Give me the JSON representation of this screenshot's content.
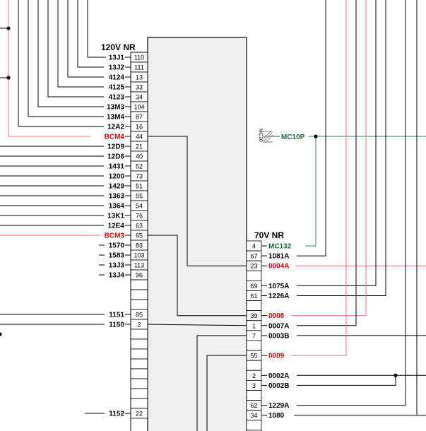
{
  "colors": {
    "black": "#000000",
    "red": "#e00000",
    "green": "#1a6b3a",
    "gray": "#707070",
    "box_fill": "#f0f0f0",
    "red_wire": "#f07070",
    "green_wire": "#2e8b57"
  },
  "left_connector": {
    "title": "120V NR",
    "rows": [
      {
        "label": "13J1",
        "pin": "110",
        "color": "black"
      },
      {
        "label": "13J2",
        "pin": "111",
        "color": "black"
      },
      {
        "label": "4124",
        "pin": "13",
        "color": "black"
      },
      {
        "label": "4125",
        "pin": "33",
        "color": "black"
      },
      {
        "label": "4123",
        "pin": "34",
        "color": "black"
      },
      {
        "label": "13M3",
        "pin": "104",
        "color": "black"
      },
      {
        "label": "13M4",
        "pin": "87",
        "color": "black"
      },
      {
        "label": "12A2",
        "pin": "16",
        "color": "black"
      },
      {
        "label": "BCM4",
        "pin": "44",
        "color": "red"
      },
      {
        "label": "12D9",
        "pin": "21",
        "color": "black"
      },
      {
        "label": "12D6",
        "pin": "40",
        "color": "black"
      },
      {
        "label": "1431",
        "pin": "52",
        "color": "black"
      },
      {
        "label": "1200",
        "pin": "73",
        "color": "black"
      },
      {
        "label": "1429",
        "pin": "51",
        "color": "black"
      },
      {
        "label": "1363",
        "pin": "55",
        "color": "black"
      },
      {
        "label": "1364",
        "pin": "54",
        "color": "black"
      },
      {
        "label": "13K1",
        "pin": "76",
        "color": "black"
      },
      {
        "label": "12E4",
        "pin": "63",
        "color": "black"
      },
      {
        "label": "BCM3",
        "pin": "65",
        "color": "red"
      },
      {
        "label": "1570",
        "pin": "83",
        "color": "black"
      },
      {
        "label": "1583",
        "pin": "103",
        "color": "black"
      },
      {
        "label": "13J3",
        "pin": "113",
        "color": "black"
      },
      {
        "label": "13J4",
        "pin": "96",
        "color": "black"
      },
      {
        "label": "",
        "pin": "",
        "color": "black"
      },
      {
        "label": "",
        "pin": "",
        "color": "black"
      },
      {
        "label": "",
        "pin": "",
        "color": "black"
      },
      {
        "label": "1151",
        "pin": "85",
        "color": "black"
      },
      {
        "label": "1150",
        "pin": "2",
        "color": "black"
      },
      {
        "label": "",
        "pin": "",
        "color": "black"
      },
      {
        "label": "",
        "pin": "",
        "color": "black"
      },
      {
        "label": "",
        "pin": "",
        "color": "black"
      },
      {
        "label": "",
        "pin": "",
        "color": "black"
      },
      {
        "label": "",
        "pin": "",
        "color": "black"
      },
      {
        "label": "",
        "pin": "",
        "color": "black"
      },
      {
        "label": "",
        "pin": "",
        "color": "black"
      },
      {
        "label": "",
        "pin": "",
        "color": "black"
      },
      {
        "label": "1152",
        "pin": "22",
        "color": "black"
      }
    ]
  },
  "right_connector": {
    "title": "70V NR",
    "rows": [
      {
        "label": "MC132",
        "pin": "4",
        "color": "green"
      },
      {
        "label": "1081A",
        "pin": "67",
        "color": "black"
      },
      {
        "label": "0004A",
        "pin": "23",
        "color": "red"
      },
      {
        "label": "",
        "pin": "",
        "color": "black"
      },
      {
        "label": "1075A",
        "pin": "69",
        "color": "black"
      },
      {
        "label": "1226A",
        "pin": "61",
        "color": "black"
      },
      {
        "label": "",
        "pin": "",
        "color": "black"
      },
      {
        "label": "0008",
        "pin": "39",
        "color": "red"
      },
      {
        "label": "0007A",
        "pin": "1",
        "color": "black"
      },
      {
        "label": "0003B",
        "pin": "7",
        "color": "black"
      },
      {
        "label": "",
        "pin": "",
        "color": "black"
      },
      {
        "label": "0009",
        "pin": "55",
        "color": "red"
      },
      {
        "label": "",
        "pin": "",
        "color": "black"
      },
      {
        "label": "0002A",
        "pin": "2",
        "color": "black"
      },
      {
        "label": "0002B",
        "pin": "3",
        "color": "black"
      },
      {
        "label": "",
        "pin": "",
        "color": "black"
      },
      {
        "label": "1229A",
        "pin": "62",
        "color": "black"
      },
      {
        "label": "1080",
        "pin": "34",
        "color": "black"
      }
    ]
  },
  "capacitor": {
    "ref": "MC10",
    "net": "MC10P"
  }
}
